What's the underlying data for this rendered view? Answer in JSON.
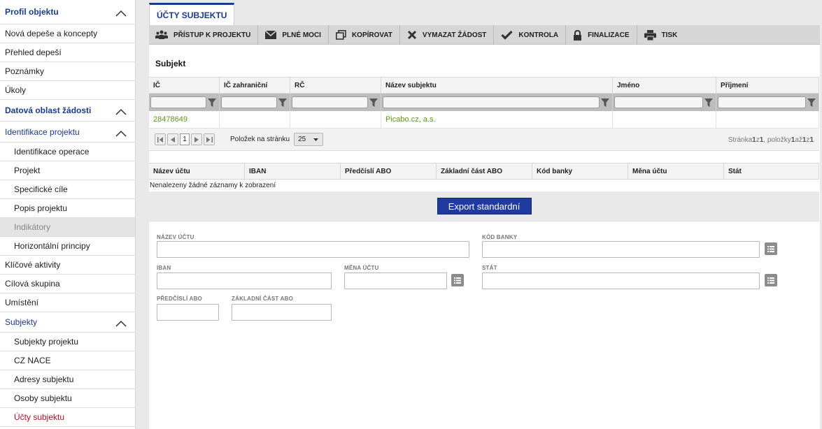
{
  "sidebar": {
    "items": [
      {
        "label": "Profil objektu"
      },
      {
        "label": "Nová depeše a koncepty"
      },
      {
        "label": "Přehled depeší"
      },
      {
        "label": "Poznámky"
      },
      {
        "label": "Úkoly"
      },
      {
        "label": "Datová oblast žádosti"
      },
      {
        "label": "Identifikace projektu"
      },
      {
        "label": "Identifikace operace"
      },
      {
        "label": "Projekt"
      },
      {
        "label": "Specifické cíle"
      },
      {
        "label": "Popis projektu"
      },
      {
        "label": "Indikátory"
      },
      {
        "label": "Horizontální principy"
      },
      {
        "label": "Klíčové aktivity"
      },
      {
        "label": "Cílová skupina"
      },
      {
        "label": "Umístění"
      },
      {
        "label": "Subjekty"
      },
      {
        "label": "Subjekty projektu"
      },
      {
        "label": "CZ NACE"
      },
      {
        "label": "Adresy subjektu"
      },
      {
        "label": "Osoby subjektu"
      },
      {
        "label": "Účty subjektu"
      }
    ]
  },
  "tab": {
    "label": "ÚČTY SUBJEKTU"
  },
  "toolbar": {
    "buttons": [
      {
        "label": "PŘÍSTUP K PROJEKTU",
        "icon": "users-icon"
      },
      {
        "label": "PLNÉ MOCI",
        "icon": "envelope-icon"
      },
      {
        "label": "KOPÍROVAT",
        "icon": "copy-icon"
      },
      {
        "label": "VYMAZAT ŽÁDOST",
        "icon": "x-icon"
      },
      {
        "label": "KONTROLA",
        "icon": "check-icon"
      },
      {
        "label": "FINALIZACE",
        "icon": "lock-icon"
      },
      {
        "label": "TISK",
        "icon": "printer-icon"
      }
    ]
  },
  "subject": {
    "title": "Subjekt",
    "columns": [
      "IČ",
      "IČ zahraniční",
      "RČ",
      "Název subjektu",
      "Jméno",
      "Příjmení"
    ],
    "rows": [
      [
        "28478649",
        "",
        "",
        "Picabo.cz, a.s.",
        "",
        ""
      ]
    ],
    "pager": {
      "page": "1",
      "per_page_label": "Položek na stránku",
      "per_page": "25",
      "info_a": "Stránka ",
      "info_b": "1",
      "info_c": " z ",
      "info_d": "1",
      "info_e": ", položky ",
      "info_f": "1",
      "info_g": " až ",
      "info_h": "1",
      "info_i": " z ",
      "info_j": "1"
    }
  },
  "accounts": {
    "columns": [
      "Název účtu",
      "IBAN",
      "Předčíslí ABO",
      "Základní část ABO",
      "Kód banky",
      "Měna účtu",
      "Stát"
    ],
    "empty": "Nenalezeny žádné záznamy k zobrazení",
    "export_label": "Export standardní"
  },
  "form": {
    "nazev_uctu": "NÁZEV ÚČTU",
    "kod_banky": "KÓD BANKY",
    "iban": "IBAN",
    "mena_uctu": "MĚNA ÚČTU",
    "stat": "STÁT",
    "predcisli": "PŘEDČÍSLÍ ABO",
    "zakladni": "ZÁKLADNÍ ČÁST ABO"
  },
  "colors": {
    "accent": "#1b3a8c",
    "active": "#b0102a",
    "link_green": "#5a9a1a",
    "button_blue": "#1f3b9f"
  }
}
